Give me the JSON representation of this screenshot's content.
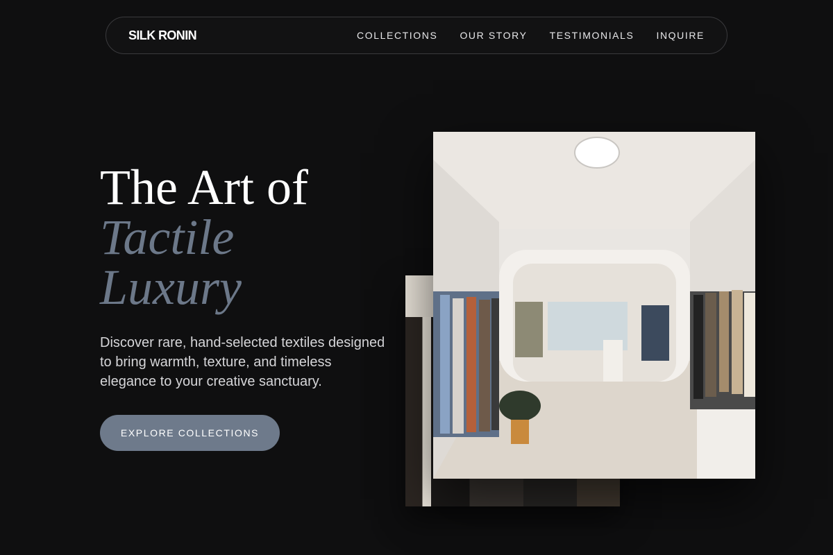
{
  "nav": {
    "brand": "SILK RONIN",
    "links": [
      "COLLECTIONS",
      "OUR STORY",
      "TESTIMONIALS",
      "INQUIRE"
    ]
  },
  "hero": {
    "headline_line1": "The Art of",
    "headline_accent_line1": "Tactile",
    "headline_accent_line2": "Luxury",
    "subtext": "Discover rare, hand-selected textiles designed to bring warmth, texture, and timeless elegance to your creative sanctuary.",
    "cta_label": "EXPLORE COLLECTIONS"
  },
  "colors": {
    "background": "#0f0f10",
    "accent": "#6e7a8b",
    "text": "#ffffff"
  }
}
